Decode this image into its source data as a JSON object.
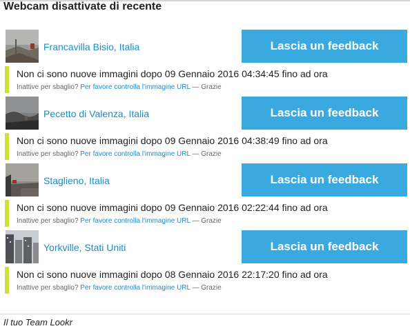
{
  "page": {
    "title": "Webcam disattivate di recente",
    "footer": "Il tuo Team Lookr"
  },
  "colors": {
    "accent": "#3aa9e0",
    "link": "#1d8bc7",
    "notice_bar": "#cfe03a"
  },
  "webcams": [
    {
      "name": "Francavilla Bisio, Italia",
      "button": "Lascia un feedback",
      "message": "Non ci sono nuove immagini dopo 09 Gennaio 2016 04:34:45 fino ad ora",
      "question": "Inattive per sbaglio?",
      "link": "Per favore controlla l'immagine URL",
      "thanks": "— Grazie"
    },
    {
      "name": "Pecetto di Valenza, Italia",
      "button": "Lascia un feedback",
      "message": "Non ci sono nuove immagini dopo 09 Gennaio 2016 04:38:49 fino ad ora",
      "question": "Inattive per sbaglio?",
      "link": "Per favore controlla l'immagine URL",
      "thanks": "— Grazie"
    },
    {
      "name": "Staglieno, Italia",
      "button": "Lascia un feedback",
      "message": "Non ci sono nuove immagini dopo 09 Gennaio 2016 02:22:44 fino ad ora",
      "question": "Inattive per sbaglio?",
      "link": "Per favore controlla l'immagine URL",
      "thanks": "— Grazie"
    },
    {
      "name": "Yorkville, Stati Uniti",
      "button": "Lascia un feedback",
      "message": "Non ci sono nuove immagini dopo 08 Gennaio 2016 22:17:20 fino ad ora",
      "question": "Inattive per sbaglio?",
      "link": "Per favore controlla l'immagine URL",
      "thanks": "— Grazie"
    }
  ]
}
